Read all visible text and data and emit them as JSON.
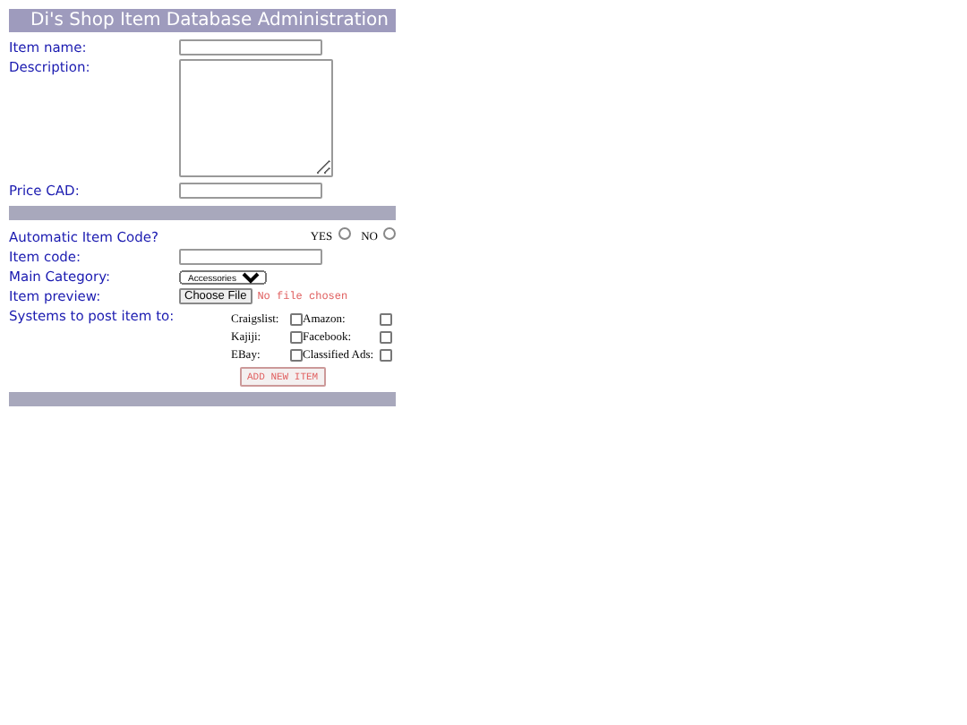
{
  "header": {
    "title": "Di's Shop Item Database Administration"
  },
  "fields": [
    {
      "kind": "text",
      "label": "Item name:"
    },
    {
      "kind": "textarea",
      "label": "Description:"
    },
    {
      "kind": "text",
      "label": "Price CAD:"
    }
  ],
  "auto_code": {
    "label": "Automatic Item Code?",
    "options": [
      {
        "label": "YES",
        "selected": false
      },
      {
        "label": "NO",
        "selected": false
      }
    ]
  },
  "item_code": {
    "label": "Item code:"
  },
  "category": {
    "label": "Main Category:",
    "value": "Accessories"
  },
  "preview": {
    "label": "Item preview:",
    "button": "Choose File",
    "status": "No file chosen"
  },
  "systems": {
    "label": "Systems to post item to:",
    "items": [
      {
        "label": "Craigslist:",
        "checked": false
      },
      {
        "label": "Amazon:",
        "checked": false
      },
      {
        "label": "Kajiji:",
        "checked": false
      },
      {
        "label": "Facebook:",
        "checked": false
      },
      {
        "label": "EBay:",
        "checked": false
      },
      {
        "label": "Classified Ads:",
        "checked": false
      }
    ]
  },
  "submit": "ADD NEW ITEM"
}
